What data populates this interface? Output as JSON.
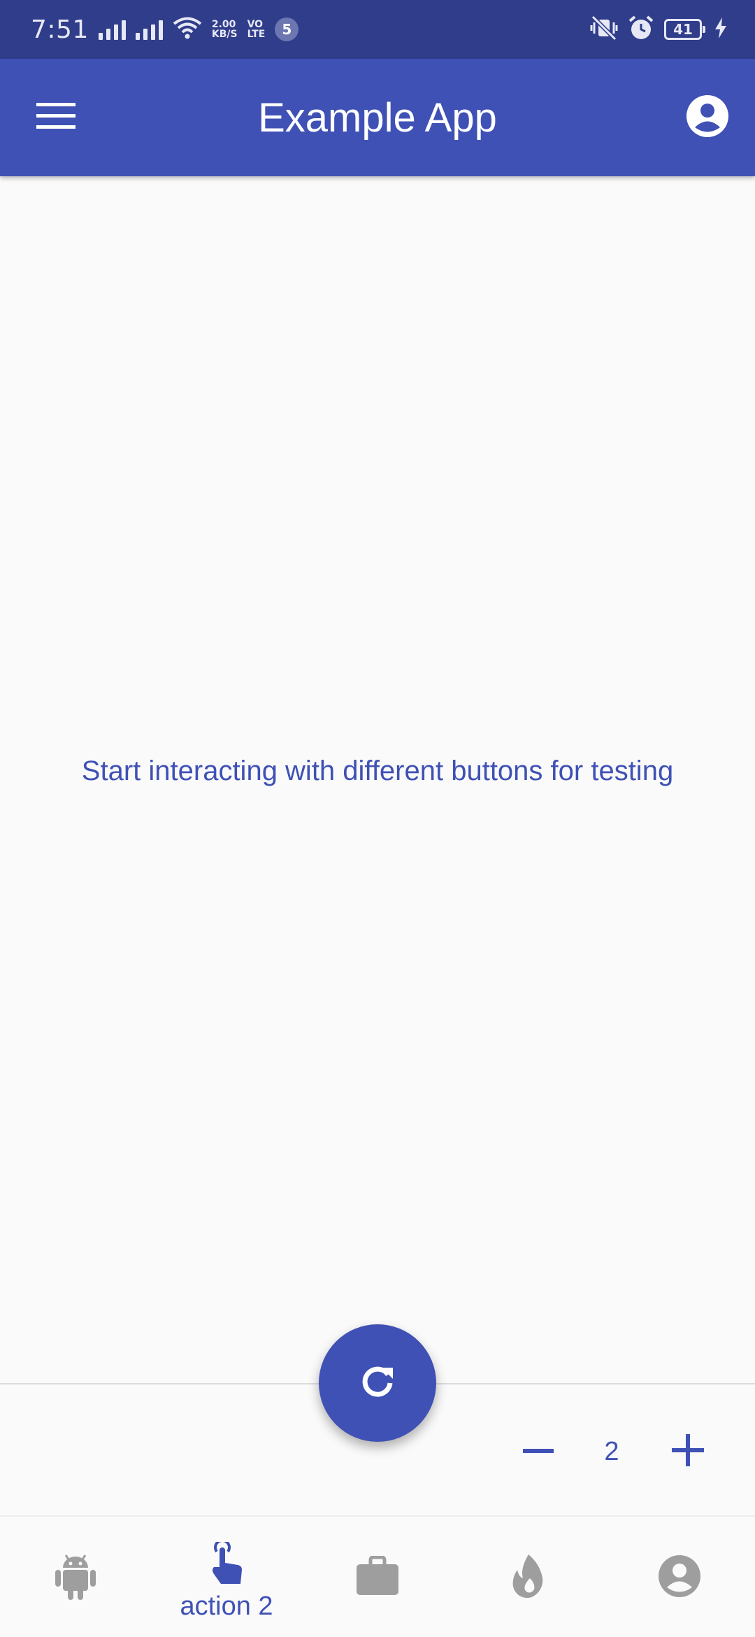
{
  "status_bar": {
    "time": "7:51",
    "data_speed_value": "2.00",
    "data_speed_unit": "KB/S",
    "volte_top": "VO",
    "volte_bottom": "LTE",
    "notification_count": "5",
    "battery_level": "41"
  },
  "app_bar": {
    "title": "Example App",
    "menu_icon": "hamburger-menu-icon",
    "account_icon": "account-circle-icon"
  },
  "content": {
    "message": "Start interacting with different buttons for testing"
  },
  "fab": {
    "icon": "refresh-icon"
  },
  "stepper": {
    "value": "2"
  },
  "bottom_nav": {
    "active_index": 1,
    "items": [
      {
        "icon": "android-icon",
        "label": ""
      },
      {
        "icon": "touch-icon",
        "label": "action 2"
      },
      {
        "icon": "briefcase-icon",
        "label": ""
      },
      {
        "icon": "flame-icon",
        "label": ""
      },
      {
        "icon": "account-circle-icon",
        "label": ""
      }
    ]
  },
  "colors": {
    "primary": "#3f51b5",
    "primary_dark": "#2f3d8a",
    "background": "#fafafa",
    "inactive_icon": "#9e9e9e"
  }
}
